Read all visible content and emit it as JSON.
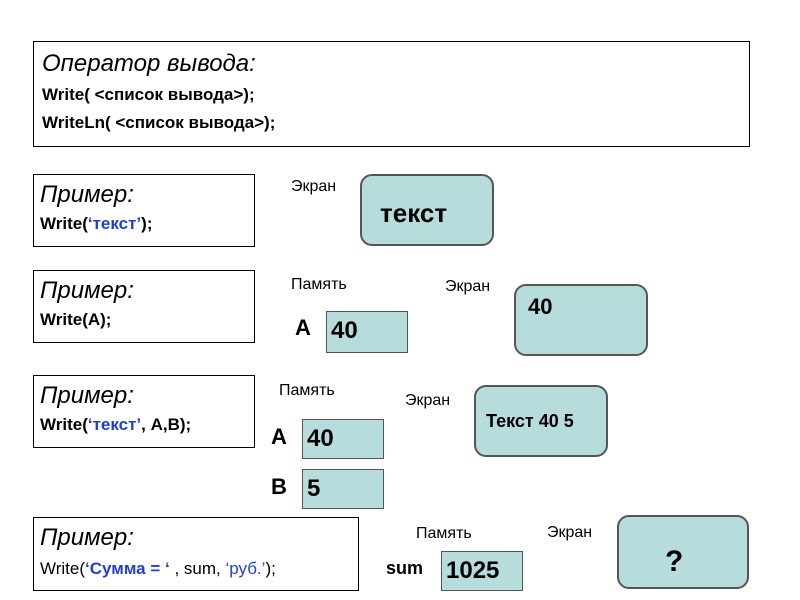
{
  "operator": {
    "title": "Оператор вывода:",
    "line1": "Write( <список вывода>);",
    "line2": "WriteLn( <список вывода>);"
  },
  "example_title": "Пример:",
  "labels": {
    "screen": "Экран",
    "memory": "Память"
  },
  "ex1": {
    "code_prefix": "Write(",
    "code_string": "‘текст’",
    "code_suffix": ");",
    "screen_text": "текст"
  },
  "ex2": {
    "code": "Write(A);",
    "var_name": "A",
    "var_value": "40",
    "screen_text": "40"
  },
  "ex3": {
    "code_prefix": "Write(",
    "code_string": "‘текст’",
    "code_suffix": ", A,B);",
    "var_a_name": "A",
    "var_a_value": "40",
    "var_b_name": "B",
    "var_b_value": "5",
    "screen_text": "Текст 40 5"
  },
  "ex4": {
    "code_prefix": "Write(",
    "code_string1": "‘Сумма = ‘",
    "code_mid": " , sum, ",
    "code_string2": "‘руб.’",
    "code_suffix": ");",
    "var_name": "sum",
    "var_value": "1025",
    "screen_text": "?"
  },
  "colors": {
    "accent_box": "#b7dcdc",
    "string_literal": "#1f3fd6"
  }
}
